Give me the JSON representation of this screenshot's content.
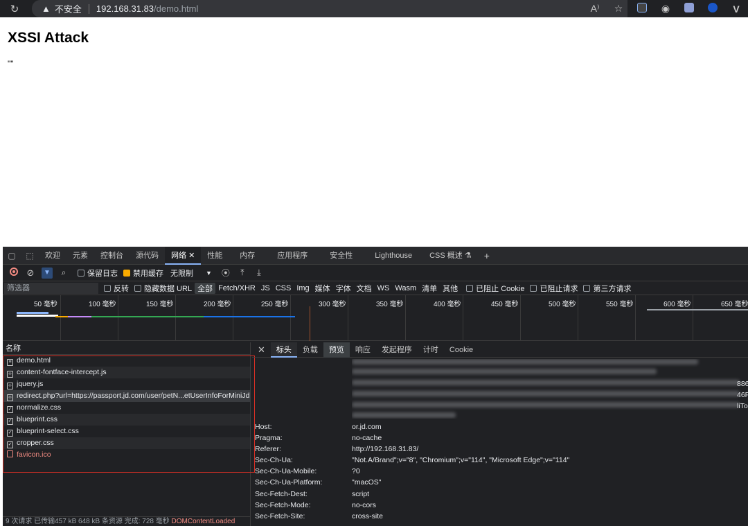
{
  "browser": {
    "insecure_label": "不安全",
    "url_host": "192.168.31.83",
    "url_path": "/demo.html"
  },
  "page": {
    "heading": "XSSI Attack",
    "output": "\"\""
  },
  "devtools": {
    "tabs": [
      "欢迎",
      "元素",
      "控制台",
      "源代码",
      "网络",
      "性能",
      "内存",
      "应用程序",
      "安全性",
      "Lighthouse",
      "CSS 概述"
    ],
    "active_tab": "网络",
    "toolbar": {
      "preserve_log": "保留日志",
      "disable_cache": "禁用缓存",
      "throttling": "无限制"
    },
    "filter": {
      "placeholder": "筛选器",
      "invert": "反转",
      "hide_data_urls": "隐藏数据 URL",
      "types": [
        "全部",
        "Fetch/XHR",
        "JS",
        "CSS",
        "Img",
        "媒体",
        "字体",
        "文档",
        "WS",
        "Wasm",
        "清单",
        "其他"
      ],
      "blocked_cookies": "已阻止 Cookie",
      "blocked_requests": "已阻止请求",
      "third_party": "第三方请求"
    },
    "timeline_ticks": [
      "50 毫秒",
      "100 毫秒",
      "150 毫秒",
      "200 毫秒",
      "250 毫秒",
      "300 毫秒",
      "350 毫秒",
      "400 毫秒",
      "450 毫秒",
      "500 毫秒",
      "550 毫秒",
      "600 毫秒",
      "650 毫秒"
    ],
    "requests_header": "名称",
    "requests": [
      {
        "name": "demo.html",
        "icon": "document-icon"
      },
      {
        "name": "content-fontface-intercept.js",
        "icon": "script-icon"
      },
      {
        "name": "jquery.js",
        "icon": "script-icon"
      },
      {
        "name": "redirect.php?url=https://passport.jd.com/user/petN...etUserInfoForMiniJd...",
        "icon": "script-icon"
      },
      {
        "name": "normalize.css",
        "icon": "stylesheet-icon"
      },
      {
        "name": "blueprint.css",
        "icon": "stylesheet-icon"
      },
      {
        "name": "blueprint-select.css",
        "icon": "stylesheet-icon"
      },
      {
        "name": "cropper.css",
        "icon": "stylesheet-icon"
      },
      {
        "name": "favicon.ico",
        "icon": "image-icon"
      }
    ],
    "status_text": "9 次请求  已传输457 kB  648 kB 条资源  完成: 728 毫秒",
    "status_dcl": "DOMContentLoaded",
    "detail_tabs": [
      "标头",
      "负载",
      "预览",
      "响应",
      "发起程序",
      "计时",
      "Cookie"
    ],
    "headers": [
      {
        "key": "Host:",
        "value": "or.jd.com"
      },
      {
        "key": "Pragma:",
        "value": "no-cache"
      },
      {
        "key": "Referer:",
        "value": "http://192.168.31.83/"
      },
      {
        "key": "Sec-Ch-Ua:",
        "value": "\"Not.A/Brand\";v=\"8\", \"Chromium\";v=\"114\", \"Microsoft Edge\";v=\"114\""
      },
      {
        "key": "Sec-Ch-Ua-Mobile:",
        "value": "?0"
      },
      {
        "key": "Sec-Ch-Ua-Platform:",
        "value": "\"macOS\""
      },
      {
        "key": "Sec-Fetch-Dest:",
        "value": "script"
      },
      {
        "key": "Sec-Fetch-Mode:",
        "value": "no-cors"
      },
      {
        "key": "Sec-Fetch-Site:",
        "value": "cross-site"
      }
    ],
    "blur_right_fragments": [
      "886",
      "46F",
      "liTo"
    ]
  }
}
